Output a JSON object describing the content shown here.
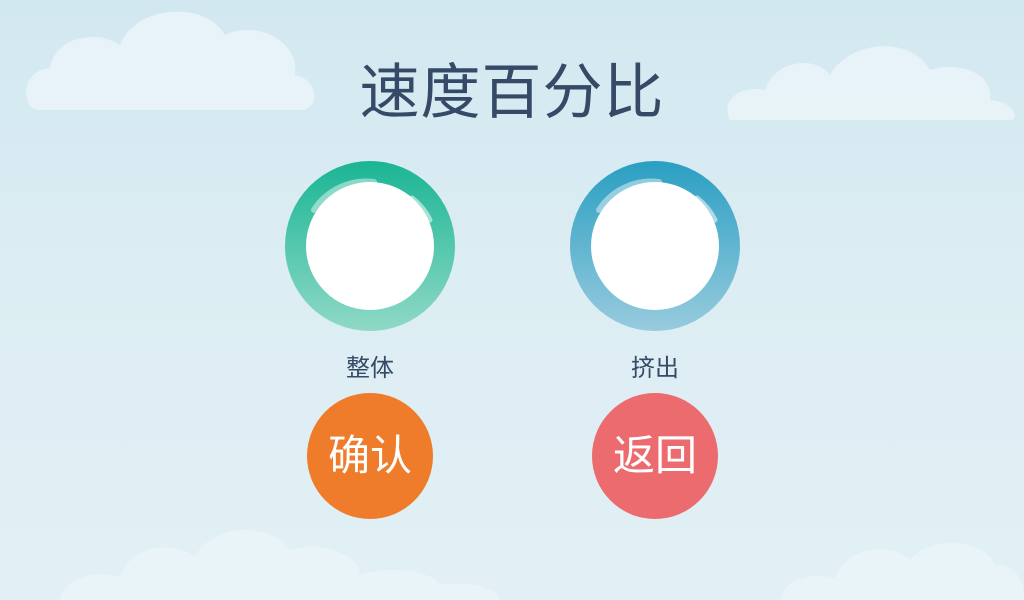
{
  "title": "速度百分比",
  "rings": [
    {
      "label": "整体",
      "value": "",
      "color": "#1fbf9f"
    },
    {
      "label": "挤出",
      "value": "",
      "color": "#2c9ec1"
    }
  ],
  "buttons": {
    "confirm_label": "确认",
    "back_label": "返回"
  },
  "colors": {
    "background": "#d2e8f0",
    "title_text": "#344a66",
    "confirm": "#ee7c2b",
    "back": "#ec6b6e"
  }
}
